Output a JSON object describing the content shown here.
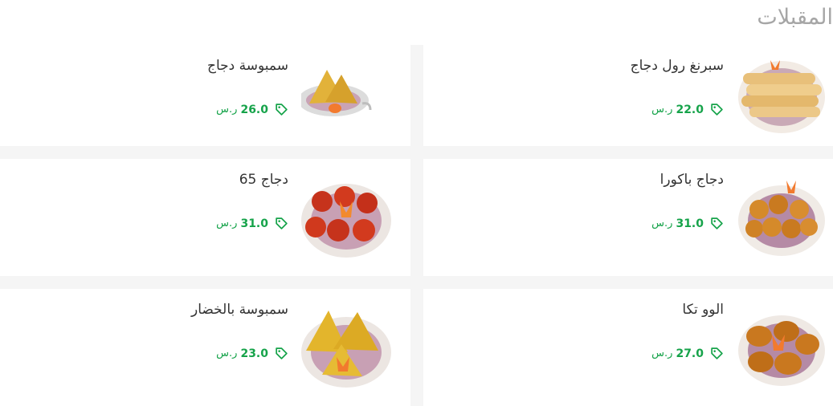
{
  "section": {
    "title": "المقبلات"
  },
  "colors": {
    "price": "#16a34a",
    "title": "#a6a6a6",
    "name": "#333333"
  },
  "items": [
    {
      "name": "سبرنغ رول دجاج",
      "price": "22.0",
      "currency": "ر.س",
      "icon": "tag-icon",
      "image": "spring-rolls"
    },
    {
      "name": "سمبوسة دجاج",
      "price": "26.0",
      "currency": "ر.س",
      "icon": "tag-icon",
      "image": "chicken-samosa"
    },
    {
      "name": "دجاج باكورا",
      "price": "31.0",
      "currency": "ر.س",
      "icon": "tag-icon",
      "image": "chicken-pakora"
    },
    {
      "name": "دجاج 65",
      "price": "31.0",
      "currency": "ر.س",
      "icon": "tag-icon",
      "image": "chicken-65"
    },
    {
      "name": "الوو تكا",
      "price": "27.0",
      "currency": "ر.س",
      "icon": "tag-icon",
      "image": "aloo-tikka"
    },
    {
      "name": "سمبوسة بالخضار",
      "price": "23.0",
      "currency": "ر.س",
      "icon": "tag-icon",
      "image": "veg-samosa"
    }
  ]
}
